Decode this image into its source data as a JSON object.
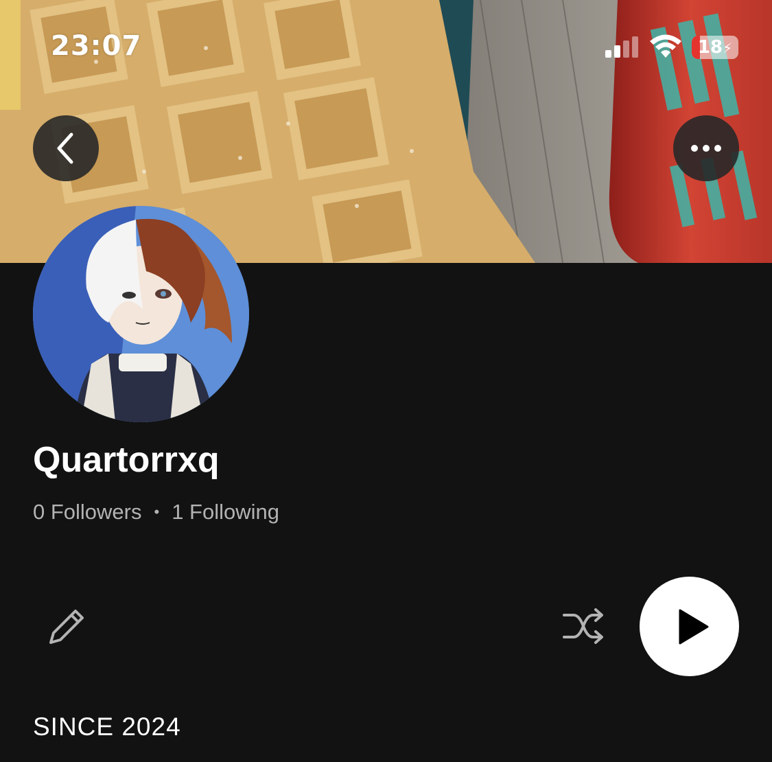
{
  "status_bar": {
    "time": "23:07",
    "battery_level": "18",
    "battery_charging": true
  },
  "header": {
    "back_icon": "chevron-left-icon",
    "more_icon": "more-horizontal-icon"
  },
  "profile": {
    "name": "Quartorrxq",
    "followers": "0 Followers",
    "separator": "•",
    "following": "1 Following"
  },
  "actions": {
    "edit_icon": "pencil-icon",
    "shuffle_icon": "shuffle-icon",
    "play_icon": "play-icon"
  },
  "section": {
    "since_label": "SINCE 2024"
  },
  "colors": {
    "background": "#121212",
    "text_primary": "#ffffff",
    "text_secondary": "#b3b3b3",
    "battery_low": "#e5332e",
    "play_button": "#ffffff"
  }
}
